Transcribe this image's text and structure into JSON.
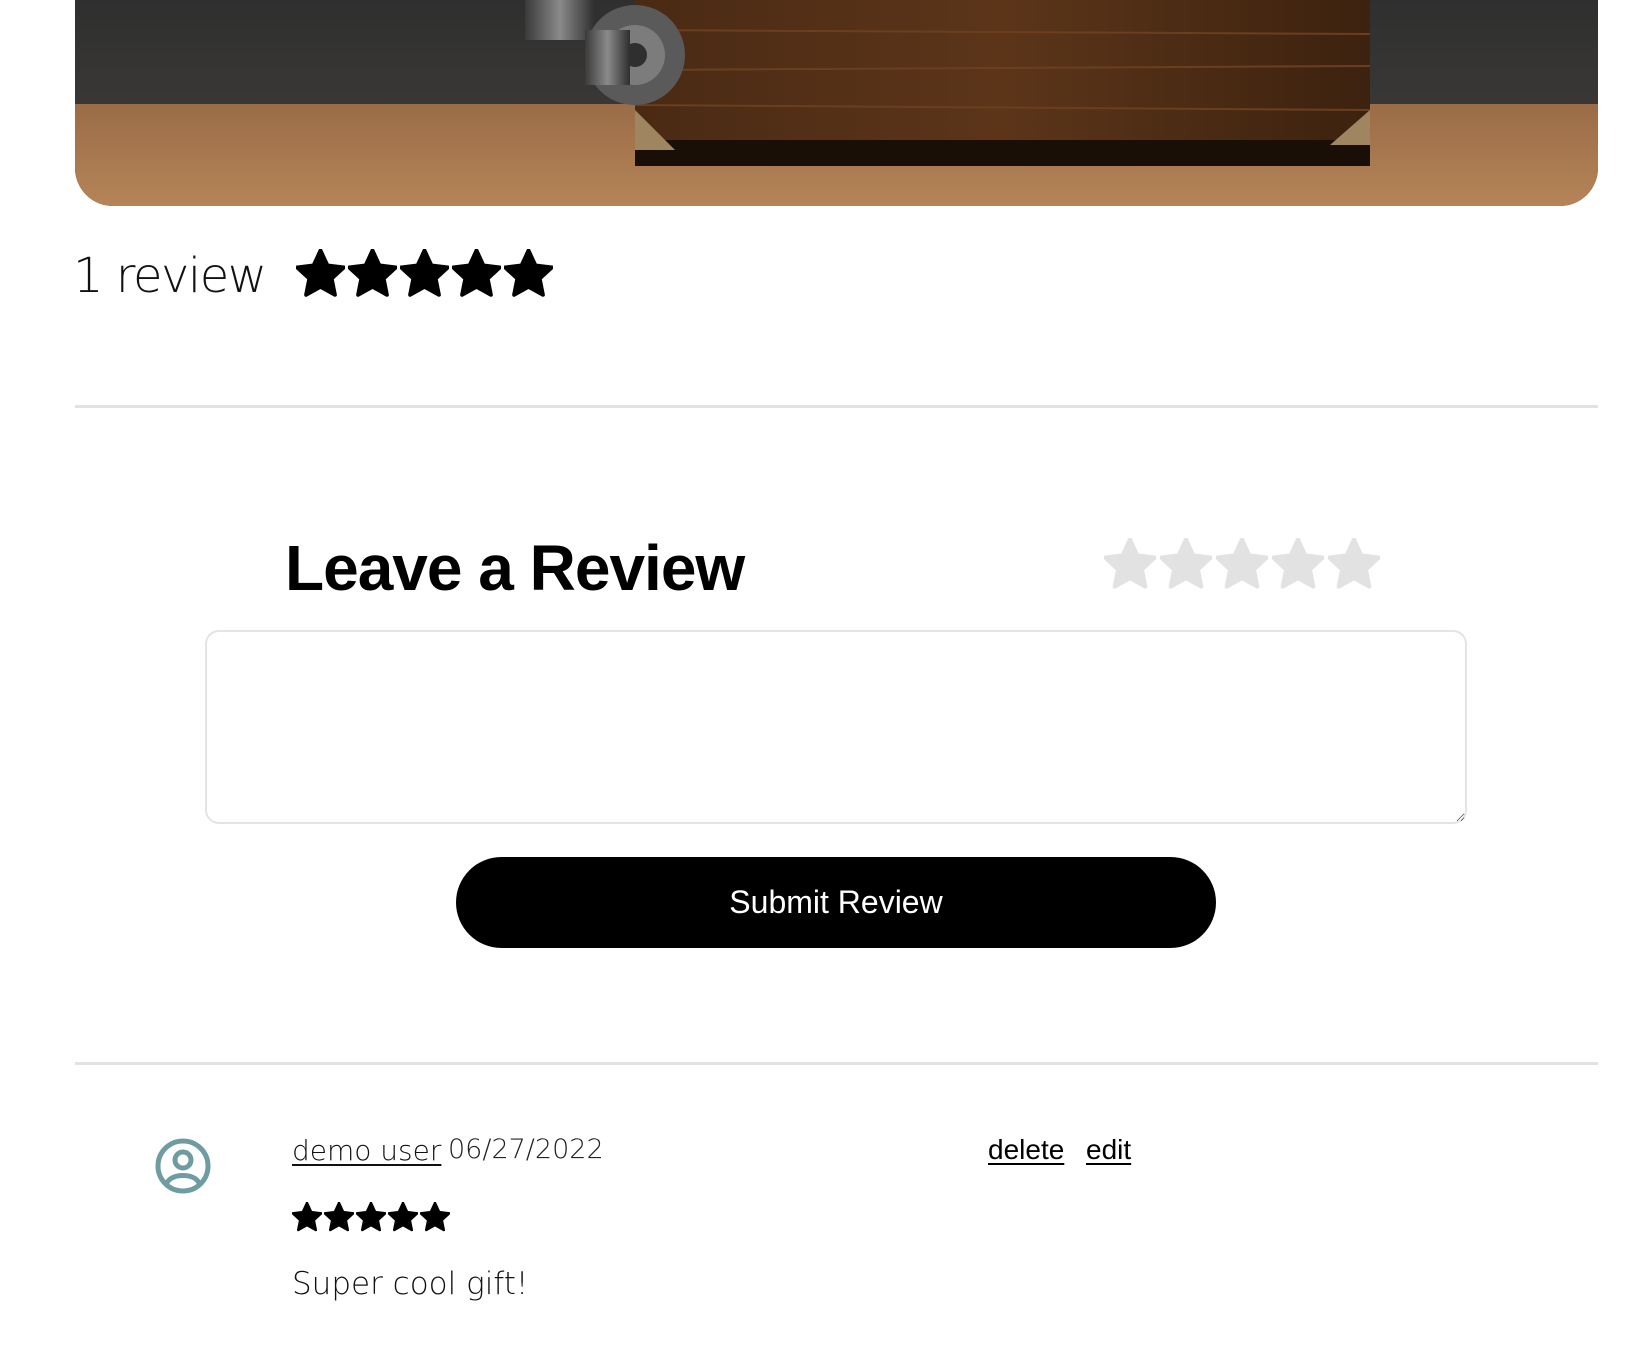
{
  "summary": {
    "review_count_label": "1 review",
    "average_rating": 5,
    "max_rating": 5
  },
  "leave_review": {
    "title": "Leave a Review",
    "selected_rating": 0,
    "max_rating": 5,
    "textarea_value": "",
    "submit_label": "Submit Review"
  },
  "reviews": [
    {
      "user": "demo user",
      "date": "06/27/2022",
      "rating": 5,
      "text": "Super cool gift!",
      "delete_label": "delete",
      "edit_label": "edit",
      "avatar_icon": "user-circle-icon"
    }
  ],
  "colors": {
    "star_filled": "#000000",
    "star_empty": "#e2e2e2",
    "divider": "#e2e2e2",
    "button_bg": "#000000",
    "button_text": "#ffffff",
    "avatar": "#6f9ca1"
  }
}
